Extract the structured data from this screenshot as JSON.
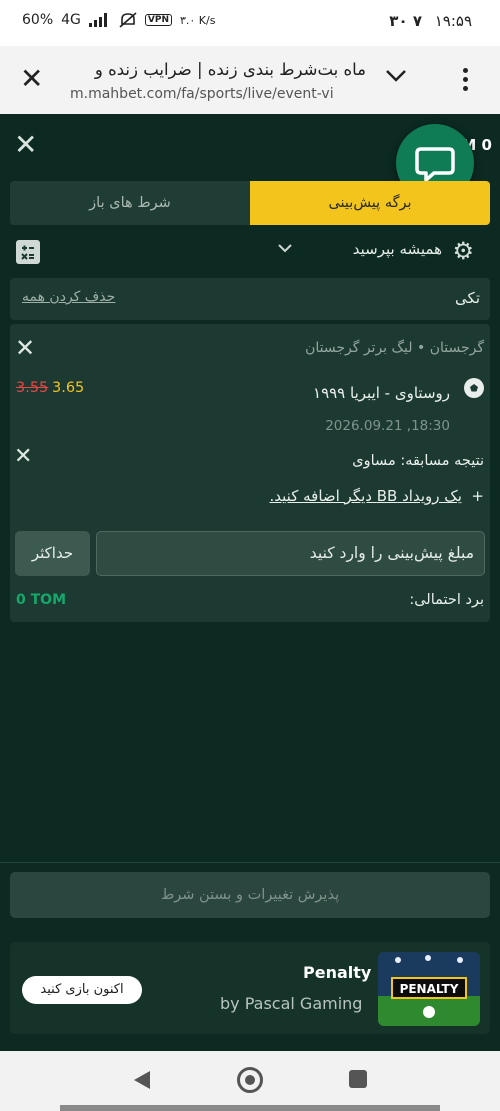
{
  "status_bar": {
    "time": "۱۹:۵۹",
    "date": "۳۰ ۷",
    "battery": "60%",
    "network": "4G",
    "vpn": "VPN",
    "speed": "۳.۰ K/s"
  },
  "browser": {
    "page_title": "ماه بت‌شرط بندی زنده | ضرایب زنده و",
    "url": "m.mahbet.com/fa/sports/live/event-vi"
  },
  "header": {
    "balance_fragment": "M 0"
  },
  "tabs": {
    "betslip": "برگه پیش‌بینی",
    "open_bets": "شرط های باز"
  },
  "odds_setting": {
    "label": "همیشه بپرسید"
  },
  "bet_type": {
    "label": "تکی",
    "delete_all": "حذف کردن همه"
  },
  "selection": {
    "league": "گرجستان • لیگ برتر گرجستان",
    "match": "روستاوی - ایبریا ۱۹۹۹",
    "old_odds": "3.55",
    "new_odds": "3.65",
    "datetime": "2026.09.21 ,18:30",
    "result": "نتیجه مسابقه: مساوی",
    "add_event_plus": "+",
    "add_event": "یک رویداد BB دیگر اضافه کنید."
  },
  "stake": {
    "placeholder": "مبلغ پیش‌بینی را وارد کنید",
    "max_label": "حداکثر",
    "potential_label": "برد احتمالی:",
    "potential_value": "0 TOM"
  },
  "accept_button": "پذیرش تغییرات و بستن شرط",
  "promo": {
    "title": "Penalty",
    "subtitle": "by Pascal Gaming",
    "cta": "اکنون بازی کنید",
    "thumb_text": "PENALTY"
  },
  "colors": {
    "accent": "#f2c41c",
    "background": "#0c2a22",
    "positive": "#14a86b",
    "odds_drop": "#e64545"
  }
}
